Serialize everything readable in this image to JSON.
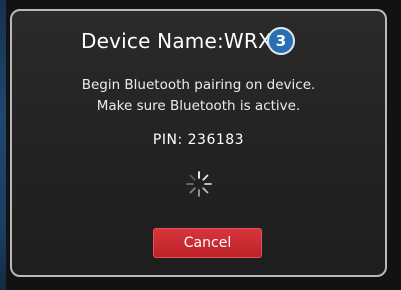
{
  "dialog": {
    "title": "Device Name:WRX",
    "step_badge": "3",
    "message_line1": "Begin Bluetooth pairing on device.",
    "message_line2": "Make sure Bluetooth is active.",
    "pin_text": "PIN: 236183",
    "spinner_icon": "loading-spinner-icon",
    "cancel_label": "Cancel"
  },
  "colors": {
    "background": "#121212",
    "dialog_border": "#b9b9b9",
    "badge": "#2b6fb3",
    "cancel_button": "#c9272e",
    "side_accent": "#1f4770"
  }
}
